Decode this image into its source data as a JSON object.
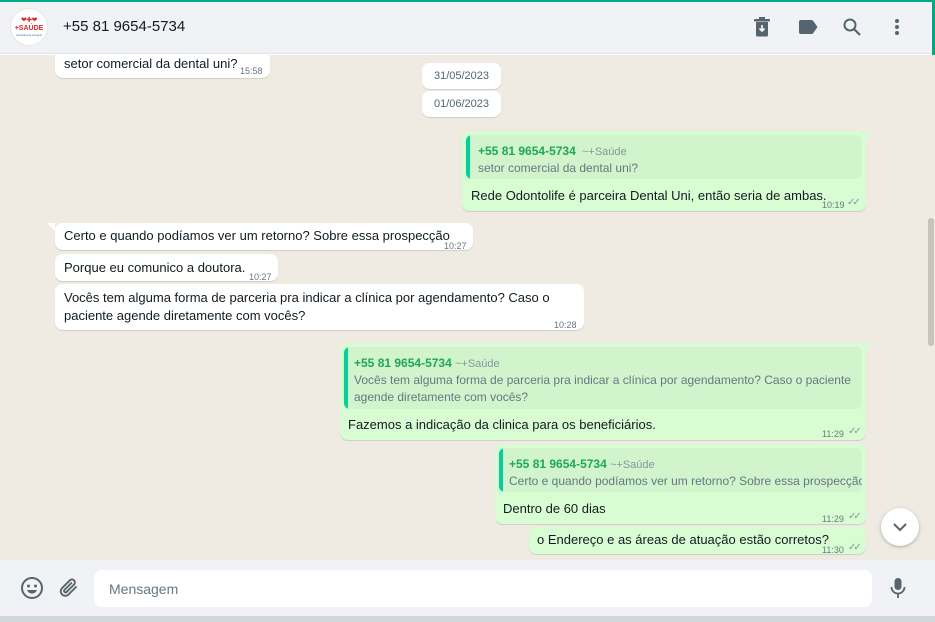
{
  "header": {
    "contact_name": "+55 81 9654-5734",
    "avatar": {
      "logo_main": "+SAÚDE",
      "logo_sub": "assistência integral",
      "logo_top": "❤✚❤"
    },
    "icons": [
      "archive-icon",
      "label-icon",
      "search-icon",
      "menu-icon"
    ]
  },
  "messages": [
    {
      "id": "m0",
      "direction": "in",
      "text": "setor comercial da dental uni?",
      "time": "15:58"
    },
    {
      "id": "d1",
      "type": "date",
      "text": "31/05/2023"
    },
    {
      "id": "d2",
      "type": "date",
      "text": "01/06/2023"
    },
    {
      "id": "m1",
      "direction": "out",
      "quote_name": "+55 81 9654-5734",
      "quote_alias": "~+Saúde",
      "quote_text": "setor comercial da dental uni?",
      "text": "Rede Odontolife é parceira Dental Uni, então seria de ambas.",
      "time": "10:19"
    },
    {
      "id": "m2",
      "direction": "in",
      "text": "Certo e quando podíamos ver um retorno? Sobre essa prospecção",
      "time": "10:27"
    },
    {
      "id": "m3",
      "direction": "in",
      "text": "Porque eu comunico a doutora.",
      "time": "10:27"
    },
    {
      "id": "m4",
      "direction": "in",
      "text_line1": "Vocês tem alguma forma de parceria pra indicar a clínica por agendamento? Caso o",
      "text_line2": "paciente agende diretamente com vocês?",
      "time": "10:28"
    },
    {
      "id": "m5",
      "direction": "out",
      "quote_name": "+55 81 9654-5734",
      "quote_alias": "~+Saúde",
      "quote_line1": "Vocês tem alguma forma de parceria pra indicar a clínica por agendamento? Caso o paciente",
      "quote_line2": "agende diretamente com vocês?",
      "text": "Fazemos a indicação da clinica para os beneficiários.",
      "time": "11:29"
    },
    {
      "id": "m6",
      "direction": "out",
      "quote_name": "+55 81 9654-5734",
      "quote_alias": "~+Saúde",
      "quote_text": "Certo e quando podíamos ver um retorno? Sobre essa prospecção",
      "text": "Dentro de 60 dias",
      "time": "11:29"
    },
    {
      "id": "m7",
      "direction": "out",
      "text": "o Endereço e as áreas de atuação estão corretos?",
      "time": "11:30"
    }
  ],
  "footer": {
    "placeholder": "Mensagem",
    "icons": [
      "emoji-icon",
      "attach-icon",
      "mic-icon"
    ]
  },
  "colors": {
    "accent": "#00a884",
    "outgoing_bubble": "#d9fdd3",
    "chat_background": "#efeae2",
    "quote_name": "#1fa855"
  }
}
